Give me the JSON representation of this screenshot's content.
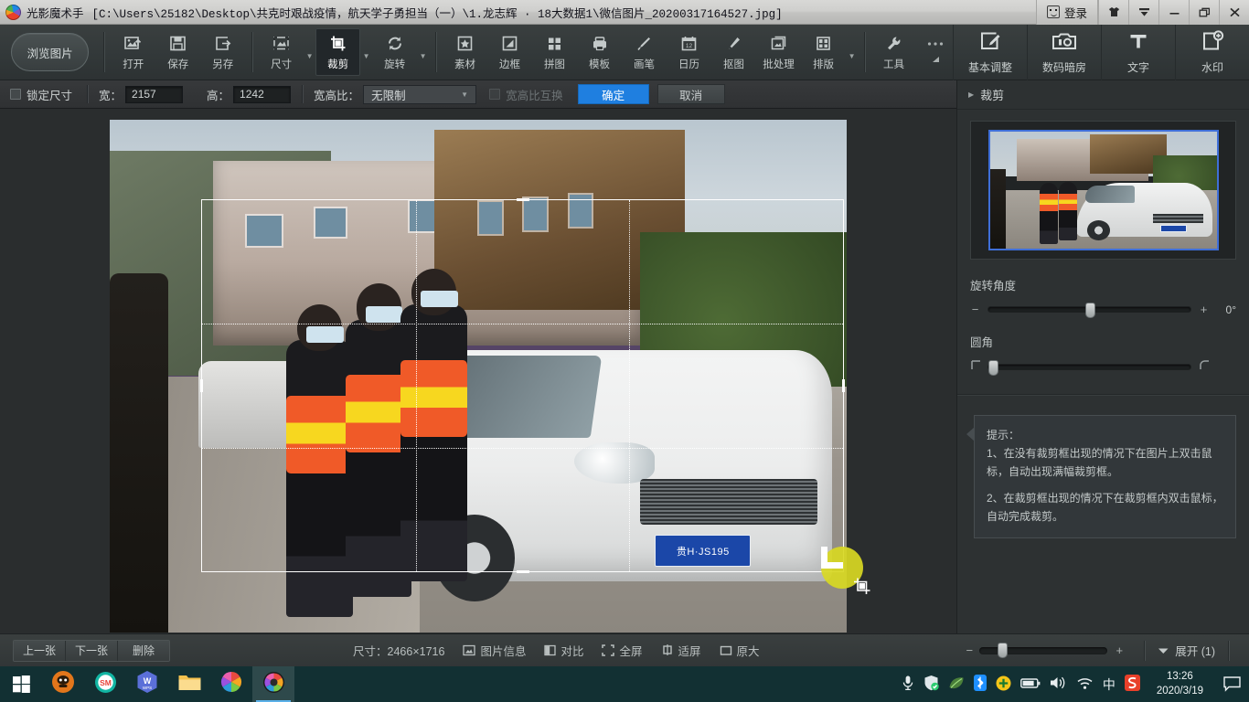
{
  "titlebar": {
    "app_name": "光影魔术手",
    "file_path": "[C:\\Users\\25182\\Desktop\\共克时艰战疫情，航天学子勇担当（一）\\1.龙志辉 · 18大数据1\\微信图片_20200317164527.jpg]",
    "login_label": "登录",
    "buttons": [
      {
        "name": "skin-icon",
        "glyph": "skin"
      },
      {
        "name": "menu-icon",
        "glyph": "menu"
      },
      {
        "name": "minimize-icon",
        "glyph": "min"
      },
      {
        "name": "restore-icon",
        "glyph": "restore"
      },
      {
        "name": "close-icon",
        "glyph": "close"
      }
    ]
  },
  "toolbar": {
    "browse_label": "浏览图片",
    "group1": [
      {
        "label": "打开",
        "icon": "open-image-icon"
      },
      {
        "label": "保存",
        "icon": "save-icon"
      },
      {
        "label": "另存",
        "icon": "save-as-icon"
      }
    ],
    "group2": [
      {
        "label": "尺寸",
        "icon": "resize-icon",
        "dropdown": true,
        "active": false
      },
      {
        "label": "裁剪",
        "icon": "crop-icon",
        "dropdown": true,
        "active": true
      },
      {
        "label": "旋转",
        "icon": "rotate-icon",
        "dropdown": true,
        "active": false
      }
    ],
    "group3": [
      {
        "label": "素材",
        "icon": "sticker-icon"
      },
      {
        "label": "边框",
        "icon": "frame-icon"
      },
      {
        "label": "拼图",
        "icon": "collage-icon"
      },
      {
        "label": "模板",
        "icon": "template-icon"
      },
      {
        "label": "画笔",
        "icon": "brush-icon"
      },
      {
        "label": "日历",
        "icon": "calendar-icon"
      },
      {
        "label": "抠图",
        "icon": "cutout-icon"
      },
      {
        "label": "批处理",
        "icon": "batch-icon"
      },
      {
        "label": "排版",
        "icon": "layout-icon",
        "dropdown": true
      }
    ],
    "group4": [
      {
        "label": "工具",
        "icon": "wrench-icon"
      }
    ],
    "more_icon": "more-icon",
    "right_tools": [
      {
        "label": "基本调整",
        "icon": "basic-adjust-icon"
      },
      {
        "label": "数码暗房",
        "icon": "darkroom-icon"
      },
      {
        "label": "文字",
        "icon": "text-icon"
      },
      {
        "label": "水印",
        "icon": "watermark-icon"
      }
    ]
  },
  "options": {
    "lock_label": "锁定尺寸",
    "lock_checked": false,
    "width_label": "宽：",
    "width_value": "2157",
    "height_label": "高：",
    "height_value": "1242",
    "ratio_label": "宽高比：",
    "ratio_value": "无限制",
    "swap_label": "宽高比互换",
    "swap_enabled": false,
    "confirm_label": "确定",
    "cancel_label": "取消"
  },
  "canvas": {
    "license_plate": "贵H·JS195",
    "crop_cursor_icon": "crop-cursor-icon",
    "corner_handle_icon": "crop-corner-handle"
  },
  "right_panel": {
    "section_title": "裁剪",
    "rotate_label": "旋转角度",
    "rotate_value": "0°",
    "rotate_minus": "−",
    "rotate_plus": "+",
    "corner_label": "圆角",
    "tip_title": "提示：",
    "tip_1": "1、在没有裁剪框出现的情况下在图片上双击鼠标，自动出现满幅裁剪框。",
    "tip_2": "2、在裁剪框出现的情况下在裁剪框内双击鼠标，自动完成裁剪。"
  },
  "bottombar": {
    "prev_label": "上一张",
    "next_label": "下一张",
    "delete_label": "删除",
    "size_label": "尺寸：2466×1716",
    "info_label": "图片信息",
    "compare_label": "对比",
    "fullscreen_label": "全屏",
    "fitscreen_label": "适屏",
    "original_label": "原大",
    "zoom_minus": "−",
    "zoom_plus": "+",
    "expand_label": "展开 (1)"
  },
  "taskbar": {
    "start_icon": "windows-start-icon",
    "apps": [
      {
        "name": "taskbar-app-browser-orange",
        "icon": "orange-circle-icon"
      },
      {
        "name": "taskbar-app-sm",
        "icon": "sm-icon"
      },
      {
        "name": "taskbar-app-wps",
        "icon": "wps-icon"
      },
      {
        "name": "taskbar-app-explorer",
        "icon": "folder-icon"
      },
      {
        "name": "taskbar-app-photoshine",
        "icon": "color-wheel-icon"
      },
      {
        "name": "taskbar-app-neoimaging",
        "icon": "neoimaging-icon"
      }
    ],
    "tray": [
      {
        "name": "microphone-icon"
      },
      {
        "name": "security-shield-icon"
      },
      {
        "name": "leaf-icon"
      },
      {
        "name": "bluetooth-icon"
      },
      {
        "name": "update-icon"
      },
      {
        "name": "battery-icon"
      },
      {
        "name": "volume-icon"
      },
      {
        "name": "wifi-icon"
      },
      {
        "name": "ime-chinese-icon",
        "label": "中"
      },
      {
        "name": "sogou-icon"
      }
    ],
    "time": "13:26",
    "date": "2020/3/19",
    "notification_icon": "notification-icon"
  },
  "colors": {
    "accent": "#1f7fe0",
    "toolbar_bg": "#33393a",
    "panel_bg": "#2d3132",
    "taskbar_bg": "#123033",
    "crop_handle": "#d8d823"
  }
}
